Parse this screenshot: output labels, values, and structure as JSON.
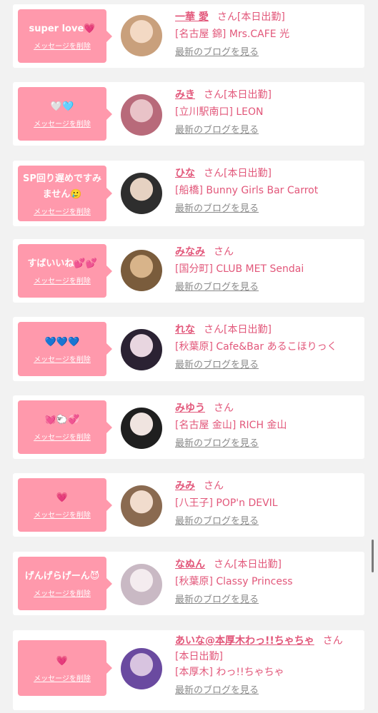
{
  "cards": [
    {
      "message": "super love💗",
      "delete_label": "メッセージを削除",
      "name": "一華 愛",
      "san": "さん",
      "status": "[本日出勤]",
      "shop": "[名古屋 錦] Mrs.CAFE 光",
      "blog": "最新のブログを見る",
      "avatar_colors": [
        "#c9a07c",
        "#f3d9c4"
      ]
    },
    {
      "message": "🤍🩵",
      "delete_label": "メッセージを削除",
      "name": "みき",
      "san": "さん",
      "status": "[本日出勤]",
      "shop": "[立川駅南口] LEON",
      "blog": "最新のブログを見る",
      "avatar_colors": [
        "#b86a7a",
        "#e9c3c8"
      ]
    },
    {
      "message": "SP回り遅めですみません🥲",
      "delete_label": "メッセージを削除",
      "name": "ひな",
      "san": "さん",
      "status": "[本日出勤]",
      "shop": "[船橋] Bunny Girls Bar Carrot",
      "blog": "最新のブログを見る",
      "avatar_colors": [
        "#2e2e2e",
        "#e6d2c2"
      ]
    },
    {
      "message": "すばいいね💕💕",
      "delete_label": "メッセージを削除",
      "name": "みなみ",
      "san": "さん",
      "status": "",
      "shop": "[国分町] CLUB MET Sendai",
      "blog": "最新のブログを見る",
      "avatar_colors": [
        "#7a5c3c",
        "#d8b48a"
      ]
    },
    {
      "message": "💙💙💙",
      "delete_label": "メッセージを削除",
      "name": "れな",
      "san": "さん",
      "status": "[本日出勤]",
      "shop": "[秋葉原] Cafe&Bar あるこほりっく",
      "blog": "最新のブログを見る",
      "avatar_colors": [
        "#2b2233",
        "#e8d6e0"
      ]
    },
    {
      "message": "💓🐑💞",
      "delete_label": "メッセージを削除",
      "name": "みゆう",
      "san": "さん",
      "status": "",
      "shop": "[名古屋 金山] RICH 金山",
      "blog": "最新のブログを見る",
      "avatar_colors": [
        "#1f1f1f",
        "#f0e4e0"
      ]
    },
    {
      "message": "💗",
      "delete_label": "メッセージを削除",
      "name": "みみ",
      "san": "さん",
      "status": "",
      "shop": "[八王子] POP'n DEVIL",
      "blog": "最新のブログを見る",
      "avatar_colors": [
        "#8a6a50",
        "#f1dccd"
      ]
    },
    {
      "message": "げんげらげーん😈",
      "delete_label": "メッセージを削除",
      "name": "なぬん",
      "san": "さん",
      "status": "[本日出勤]",
      "shop": "[秋葉原] Classy Princess",
      "blog": "最新のブログを見る",
      "avatar_colors": [
        "#c9b9c4",
        "#f4ecef"
      ]
    },
    {
      "message": "💗",
      "delete_label": "メッセージを削除",
      "name": "あいな@本厚木わっ!!ちゃちゃ",
      "san": "さん",
      "status": "[本日出勤]",
      "shop": "[本厚木] わっ!!ちゃちゃ",
      "blog": "最新のブログを見る",
      "avatar_colors": [
        "#6a4aa0",
        "#d8c4e0"
      ]
    }
  ],
  "colors": {
    "accent": "#e2577a",
    "bubble": "#ff99ac",
    "background": "#f2f2f2"
  }
}
